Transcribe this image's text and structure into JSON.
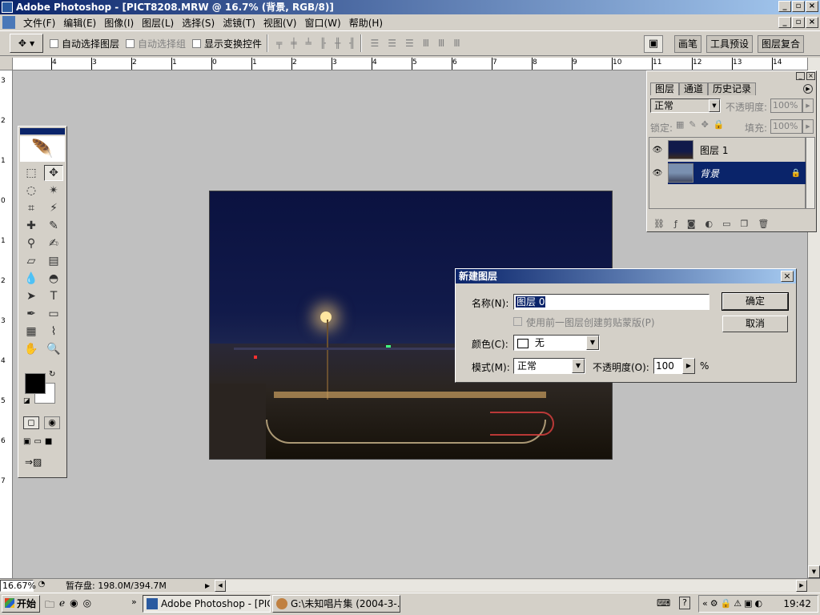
{
  "window": {
    "title": "Adobe Photoshop - [PICT8208.MRW @ 16.7% (背景, RGB/8)]"
  },
  "menu": {
    "items": [
      "文件(F)",
      "编辑(E)",
      "图像(I)",
      "图层(L)",
      "选择(S)",
      "滤镜(T)",
      "视图(V)",
      "窗口(W)",
      "帮助(H)"
    ]
  },
  "options": {
    "auto_select_layer": "自动选择图层",
    "auto_select_group": "自动选择组",
    "show_transform": "显示变换控件"
  },
  "wells": {
    "brushes": "画笔",
    "tool_presets": "工具预设",
    "layer_comps": "图层复合"
  },
  "ruler": {
    "top_labels": [
      "4",
      "3",
      "2",
      "1",
      "0",
      "1",
      "2",
      "3",
      "4",
      "5",
      "6",
      "7",
      "8",
      "9",
      "10",
      "11",
      "12",
      "13",
      "14"
    ],
    "left_labels": [
      "3",
      "2",
      "1",
      "0",
      "1",
      "2",
      "3",
      "4",
      "5",
      "6",
      "7"
    ]
  },
  "layers_panel": {
    "tabs": [
      "图层",
      "通道",
      "历史记录"
    ],
    "blend_mode": "正常",
    "opacity_label": "不透明度:",
    "opacity_value": "100%",
    "lock_label": "锁定:",
    "fill_label": "填充:",
    "fill_value": "100%",
    "layers": [
      {
        "name": "图层 1",
        "selected": false
      },
      {
        "name": "背景",
        "selected": true
      }
    ]
  },
  "dialog": {
    "title": "新建图层",
    "name_label": "名称(N):",
    "name_value": "图层 0",
    "clip_label": "使用前一图层创建剪贴蒙版(P)",
    "color_label": "颜色(C):",
    "color_value": "无",
    "mode_label": "模式(M):",
    "mode_value": "正常",
    "opacity_label": "不透明度(O):",
    "opacity_value": "100",
    "percent": "%",
    "ok": "确定",
    "cancel": "取消"
  },
  "status": {
    "zoom": "16.67%",
    "scratch": "暂存盘: 198.0M/394.7M"
  },
  "taskbar": {
    "start": "开始",
    "task1": "Adobe Photoshop - [PIC...",
    "task2": "G:\\未知唱片集 (2004-3-...",
    "time": "19:42"
  },
  "colors": {
    "title_blue": "#0a246a",
    "selection_blue": "#0a246a"
  }
}
